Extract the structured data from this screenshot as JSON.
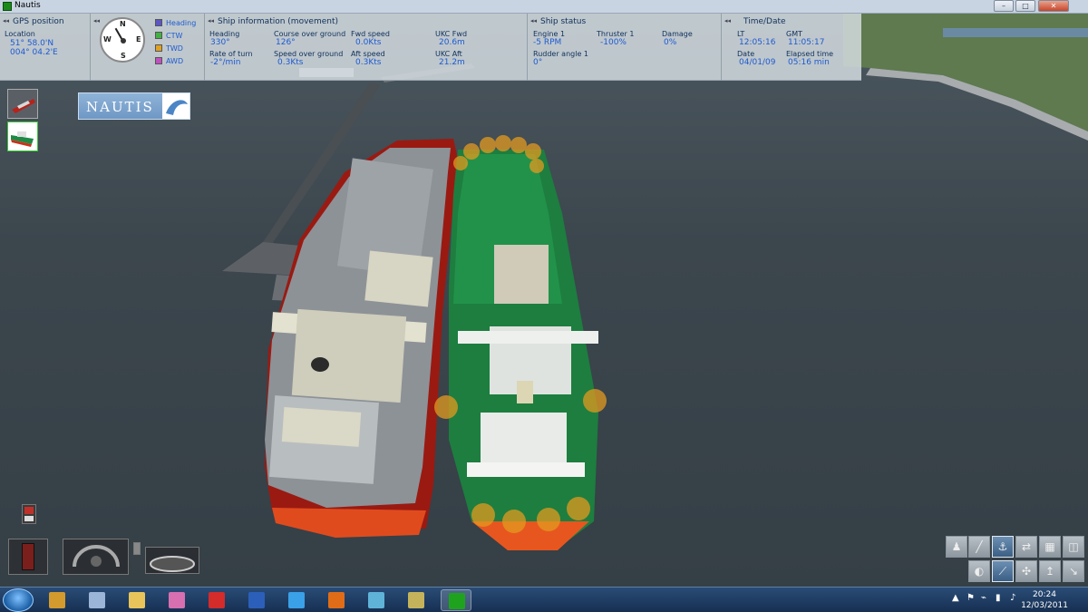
{
  "window": {
    "title": "Nautis",
    "minimize": "–",
    "maximize": "□",
    "close": "✕"
  },
  "hud": {
    "gps": {
      "arrows": "◂◂",
      "title": "GPS position",
      "location_label": "Location",
      "lat": "51° 58.0'N",
      "lon": "004° 04.2'E"
    },
    "compass": {
      "n": "N",
      "s": "S",
      "e": "E",
      "w": "W",
      "heading_deg": 330
    },
    "legend": [
      {
        "label": "Heading",
        "color": "#5b55c8"
      },
      {
        "label": "CTW",
        "color": "#43b043"
      },
      {
        "label": "TWD",
        "color": "#e0a020"
      },
      {
        "label": "AWD",
        "color": "#c050c0"
      }
    ],
    "movement": {
      "arrows": "◂◂",
      "title": "Ship information (movement)",
      "heading_label": "Heading",
      "heading": "330°",
      "rot_label": "Rate of turn",
      "rot": "-2°/min",
      "cog_label": "Course over ground",
      "cog": "126°",
      "sog_label": "Speed over ground",
      "sog": "0.3Kts",
      "fwd_label": "Fwd speed",
      "fwd": "0.0Kts",
      "aft_label": "Aft speed",
      "aft": "0.3Kts",
      "ukc_fwd_label": "UKC Fwd",
      "ukc_fwd": "20.6m",
      "ukc_aft_label": "UKC Aft",
      "ukc_aft": "21.2m"
    },
    "status": {
      "arrows": "◂◂",
      "title": "Ship status",
      "engine_label": "Engine 1",
      "engine": "-5 RPM",
      "thruster_label": "Thruster 1",
      "thruster": "-100%",
      "damage_label": "Damage",
      "damage": "0%",
      "rudder_label": "Rudder angle 1",
      "rudder": "0°"
    },
    "time": {
      "arrows": "◂◂",
      "title": "Time/Date",
      "lt_label": "LT",
      "lt": "12:05:16",
      "gmt_label": "GMT",
      "gmt": "11:05:17",
      "date_label": "Date",
      "date": "04/01/09",
      "elapsed_label": "Elapsed time",
      "elapsed": "05:16 min"
    }
  },
  "logo": {
    "text": "NAUTIS"
  },
  "taskbar": {
    "clock_time": "20:24",
    "clock_date": "12/03/2011",
    "icons": [
      {
        "name": "folder-photos-icon",
        "color": "#d39a2d"
      },
      {
        "name": "calculator-icon",
        "color": "#9ab5d8"
      },
      {
        "name": "explorer-folder-icon",
        "color": "#e8c45a"
      },
      {
        "name": "paint-icon",
        "color": "#d86fb0"
      },
      {
        "name": "acrobat-icon",
        "color": "#d42b2b"
      },
      {
        "name": "word-icon",
        "color": "#2b5fb9"
      },
      {
        "name": "messenger-icon",
        "color": "#3aa0e8"
      },
      {
        "name": "firefox-icon",
        "color": "#e06c17"
      },
      {
        "name": "notes-icon",
        "color": "#5fb3d8"
      },
      {
        "name": "network-folder-icon",
        "color": "#c4b35a"
      },
      {
        "name": "nautis-app-icon",
        "color": "#1fa31f"
      }
    ]
  }
}
